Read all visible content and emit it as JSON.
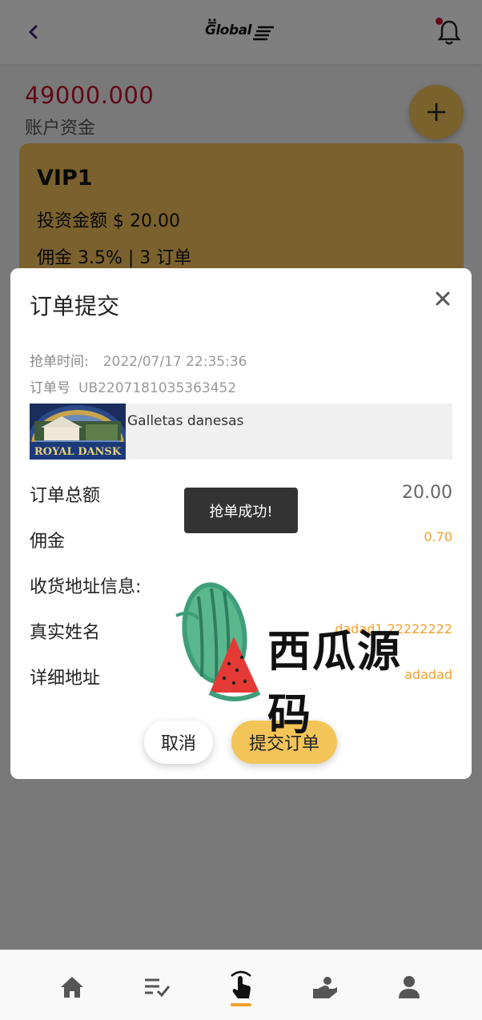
{
  "header": {
    "logo_text": "Global"
  },
  "account": {
    "balance": "49000.000",
    "balance_label": "账户资金"
  },
  "vip_card": {
    "title": "VIP1",
    "investment": "投资金额 $ 20.00",
    "commission": "佣金 3.5% | 3 订单"
  },
  "modal": {
    "title": "订单提交",
    "grab_time_label": "抢单时间:",
    "grab_time_value": "2022/07/17 22:35:36",
    "order_no_label": "订单号",
    "order_no_value": "UB2207181035363452",
    "product_name": "Galletas danesas",
    "product_image_text": "ROYAL DANSK",
    "total_label": "订单总额",
    "total_value": "20.00",
    "commission_label": "佣金",
    "commission_value": "0.70",
    "address_info_label": "收货地址信息:",
    "real_name_label": "真实姓名",
    "real_name_value": "dadad1 22222222",
    "address_label": "详细地址",
    "address_value": "adadad",
    "cancel_label": "取消",
    "submit_label": "提交订单"
  },
  "toast": {
    "message": "抢单成功!"
  },
  "watermark": {
    "text": "西瓜源码"
  },
  "colors": {
    "accent": "#f3c457",
    "balance_red": "#c8102e",
    "orange_text": "#f3a02c"
  },
  "nav": {
    "items": [
      "home-icon",
      "order-list-icon",
      "grab-order-icon",
      "wallet-icon",
      "user-icon"
    ],
    "active_index": 2
  }
}
